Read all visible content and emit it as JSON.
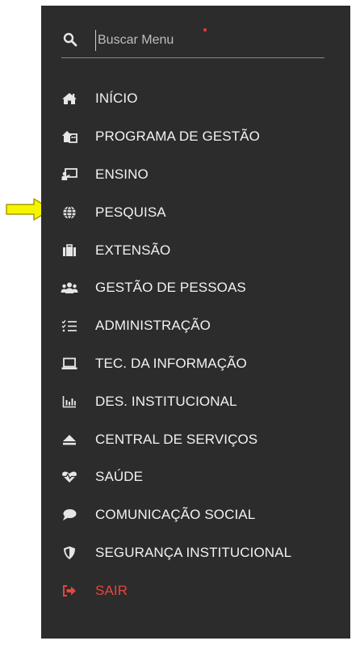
{
  "search": {
    "placeholder": "Buscar Menu",
    "icon": "search-icon"
  },
  "menu": [
    {
      "label": "INÍCIO",
      "icon": "home-icon"
    },
    {
      "label": "PROGRAMA DE GESTÃO",
      "icon": "office-icon"
    },
    {
      "label": "ENSINO",
      "icon": "chalkboard-teacher-icon"
    },
    {
      "label": "PESQUISA",
      "icon": "globe-icon"
    },
    {
      "label": "EXTENSÃO",
      "icon": "briefcase-icon"
    },
    {
      "label": "GESTÃO DE PESSOAS",
      "icon": "users-icon"
    },
    {
      "label": "ADMINISTRAÇÃO",
      "icon": "tasks-icon"
    },
    {
      "label": "TEC. DA INFORMAÇÃO",
      "icon": "laptop-icon"
    },
    {
      "label": "DES. INSTITUCIONAL",
      "icon": "bar-chart-icon"
    },
    {
      "label": "CENTRAL DE SERVIÇOS",
      "icon": "eject-icon"
    },
    {
      "label": "SAÚDE",
      "icon": "heartbeat-icon"
    },
    {
      "label": "COMUNICAÇÃO SOCIAL",
      "icon": "comment-icon"
    },
    {
      "label": "SEGURANÇA INSTITUCIONAL",
      "icon": "shield-icon"
    },
    {
      "label": "SAIR",
      "icon": "sign-out-icon"
    }
  ],
  "colors": {
    "sidebar_bg": "#2c2c2c",
    "text": "#f2f2f2",
    "logout": "#e8453c",
    "arrow": "#f5f500"
  }
}
